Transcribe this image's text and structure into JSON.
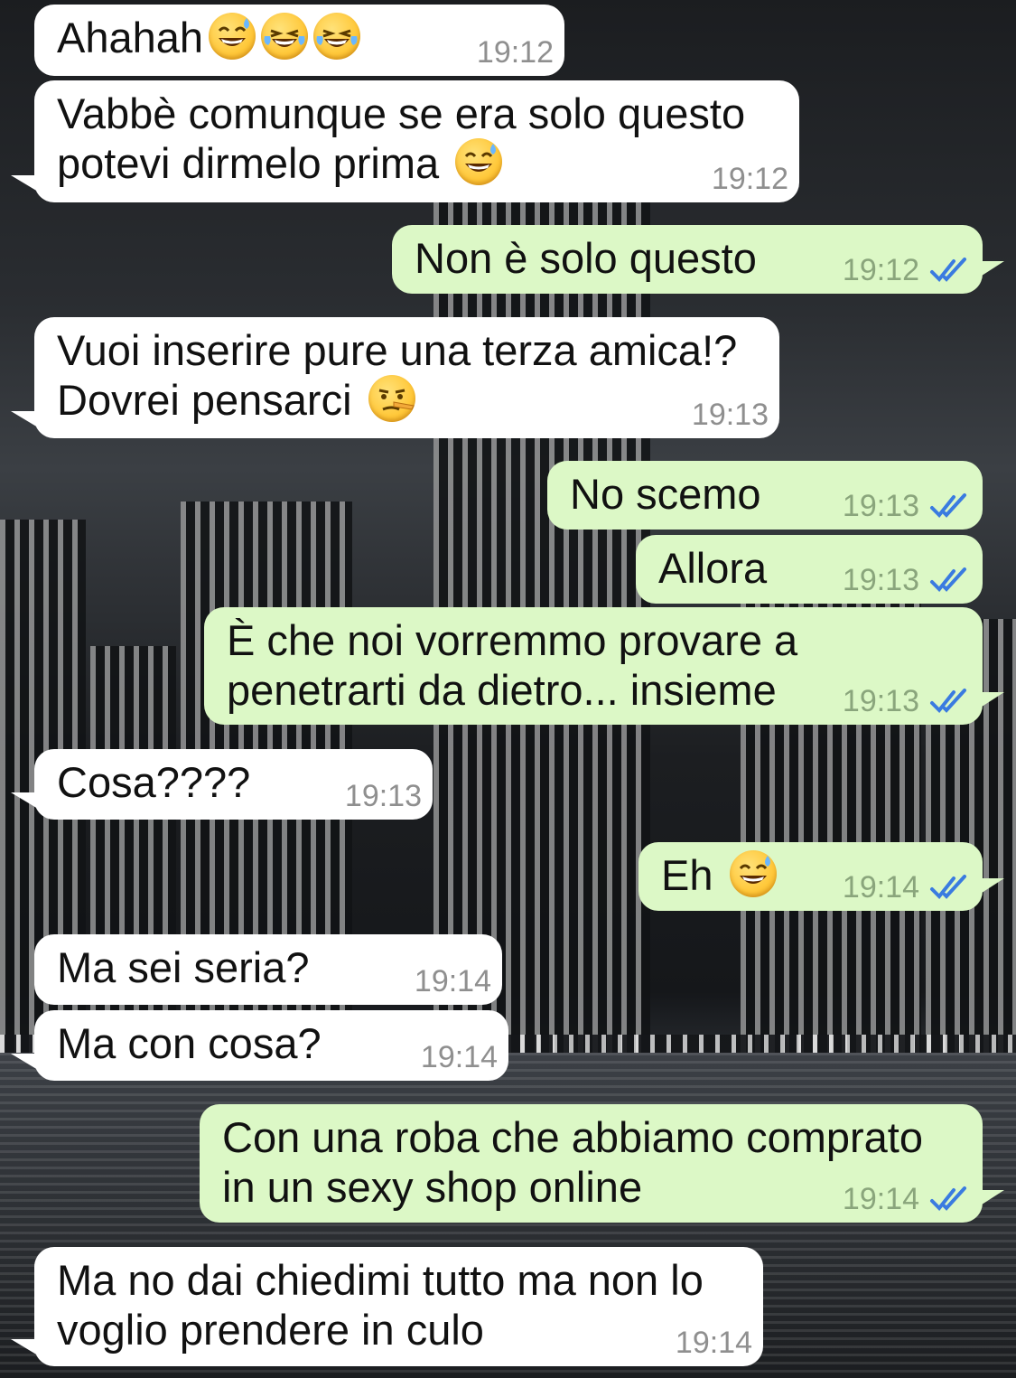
{
  "colors": {
    "incoming_bubble": "#ffffff",
    "outgoing_bubble": "#dcf8c6",
    "read_ticks": "#3a7be0",
    "timestamp": "#8f8f8f"
  },
  "messages": [
    {
      "text": "Ahahah",
      "emoji": [
        "sweat-smile-icon",
        "tears-of-joy-icon",
        "tears-of-joy-icon"
      ],
      "time": "19:12",
      "direction": "in"
    },
    {
      "text": "Vabbè comunque se era solo questo\npotevi dirmelo prima",
      "emoji": [
        "sweat-smile-icon"
      ],
      "time": "19:12",
      "direction": "in"
    },
    {
      "text": "Non è solo questo",
      "time": "19:12",
      "direction": "out",
      "status": "read"
    },
    {
      "text": "Vuoi inserire pure una terza amica!?\nDovrei pensarci",
      "emoji": [
        "lying-face-icon"
      ],
      "time": "19:13",
      "direction": "in"
    },
    {
      "text": "No scemo",
      "time": "19:13",
      "direction": "out",
      "status": "read"
    },
    {
      "text": "Allora",
      "time": "19:13",
      "direction": "out",
      "status": "read"
    },
    {
      "text": "È che noi vorremmo provare a\npenetrarti da dietro... insieme",
      "time": "19:13",
      "direction": "out",
      "status": "read"
    },
    {
      "text": "Cosa????",
      "time": "19:13",
      "direction": "in"
    },
    {
      "text": "Eh",
      "emoji": [
        "sweat-smile-icon"
      ],
      "time": "19:14",
      "direction": "out",
      "status": "read"
    },
    {
      "text": "Ma sei seria?",
      "time": "19:14",
      "direction": "in"
    },
    {
      "text": "Ma con cosa?",
      "time": "19:14",
      "direction": "in"
    },
    {
      "text": "Con una roba che abbiamo comprato\nin un sexy shop online",
      "time": "19:14",
      "direction": "out",
      "status": "read"
    },
    {
      "text": "Ma no dai chiedimi tutto ma non lo\nvoglio prendere in culo",
      "time": "19:14",
      "direction": "in"
    }
  ]
}
